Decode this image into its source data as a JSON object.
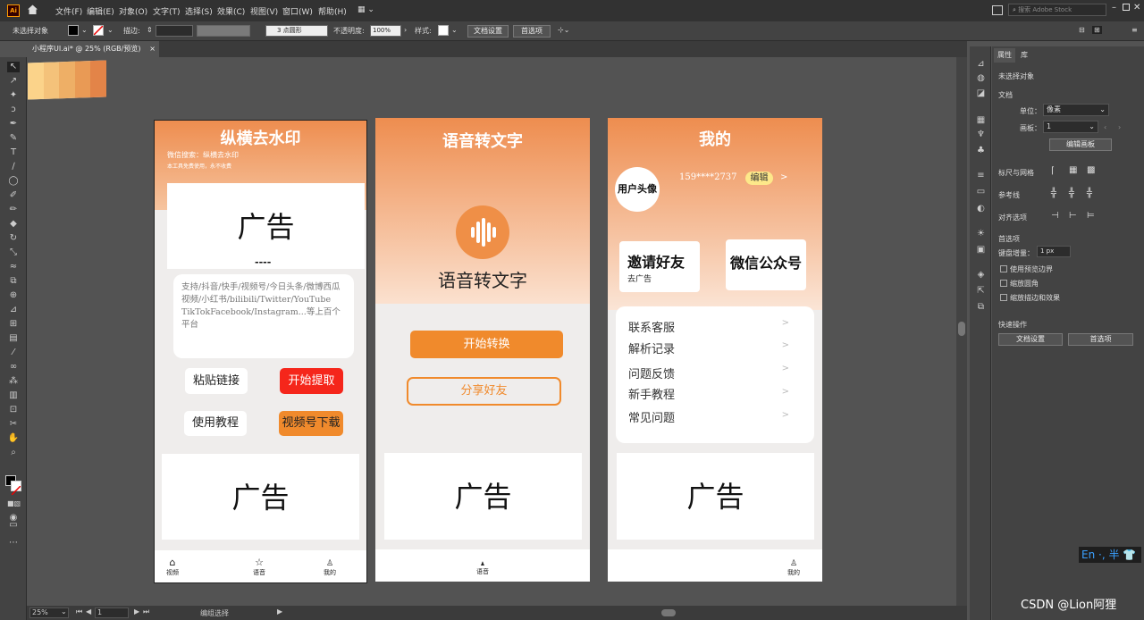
{
  "menubar": {
    "logo": "Ai",
    "menus": [
      "文件(F)",
      "编辑(E)",
      "对象(O)",
      "文字(T)",
      "选择(S)",
      "效果(C)",
      "视图(V)",
      "窗口(W)",
      "帮助(H)"
    ],
    "search_placeholder": "搜索 Adobe Stock"
  },
  "ctrlbar": {
    "no_selection": "未选择对象",
    "stroke_label": "描边:",
    "brush_label": "3 点圆形",
    "opacity_label": "不透明度:",
    "opacity_value": "100%",
    "style_label": "样式:",
    "doc_setup": "文档设置",
    "prefs": "首选项"
  },
  "tab": {
    "title": "小程序UI.ai* @ 25% (RGB/预览)",
    "close": "×"
  },
  "swatches": [
    "#fbd38a",
    "#f4c27a",
    "#eeaf66",
    "#e99a55",
    "#e38448"
  ],
  "phone1": {
    "title": "纵横去水印",
    "subtitle": "微信搜索：纵横去水印",
    "note": "本工具免费使用，永不收费",
    "ad_top": "广告",
    "ad_dash": "----",
    "input_text": "支持/抖音/快手/视频号/今日头条/微博西瓜视频/小红书/bilibili/Twitter/YouTube TikTokFacebook/Instagram...等上百个平台",
    "paste_btn": "粘贴链接",
    "start_btn": "开始提取",
    "tutorial_btn": "使用教程",
    "video_btn": "视频号下载",
    "ad_bottom": "广告",
    "nav": [
      {
        "label": "视频"
      },
      {
        "label": "语音"
      },
      {
        "label": "我的"
      }
    ]
  },
  "phone2": {
    "title": "语音转文字",
    "heading": "语音转文字",
    "start_btn": "开始转换",
    "share_btn": "分享好友",
    "ad": "广告",
    "nav_label": "语音"
  },
  "phone3": {
    "title": "我的",
    "avatar": "用户头像",
    "phone_number": "159****2737",
    "edit": "编辑",
    "chevron": ">",
    "invite_title": "邀请好友",
    "invite_sub": "去广告",
    "wechat_title": "微信公众号",
    "menu": [
      "联系客服",
      "解析记录",
      "问题反馈",
      "新手教程",
      "常见问题"
    ],
    "ad": "广告",
    "nav_label": "我的"
  },
  "status": {
    "zoom": "25%",
    "page": "1",
    "tool": "编组选择"
  },
  "panel": {
    "tab_props": "属性",
    "tab_lib": "库",
    "no_selection": "未选择对象",
    "doc": "文档",
    "unit_label": "单位：",
    "unit_value": "像素",
    "artboard_label": "画板：",
    "artboard_value": "1",
    "edit_artboard": "编辑画板",
    "rulers": "标尺与网格",
    "guides": "参考线",
    "align": "对齐选项",
    "prefs": "首选项",
    "key_inc_label": "键盘增量：",
    "key_inc_value": "1 px",
    "cb1": "使用预览边界",
    "cb2": "缩放圆角",
    "cb3": "缩放描边和效果",
    "quick": "快速操作",
    "doc_setup": "文档设置",
    "prefs_btn": "首选项"
  },
  "ime": "En ·, 半 ",
  "watermark": "CSDN @Lion阿狸",
  "colors": {
    "orange": "#f08a2c",
    "red": "#f5261b",
    "grad_top": "#ee8d4f",
    "grad_bottom": "#f8e4d6"
  }
}
